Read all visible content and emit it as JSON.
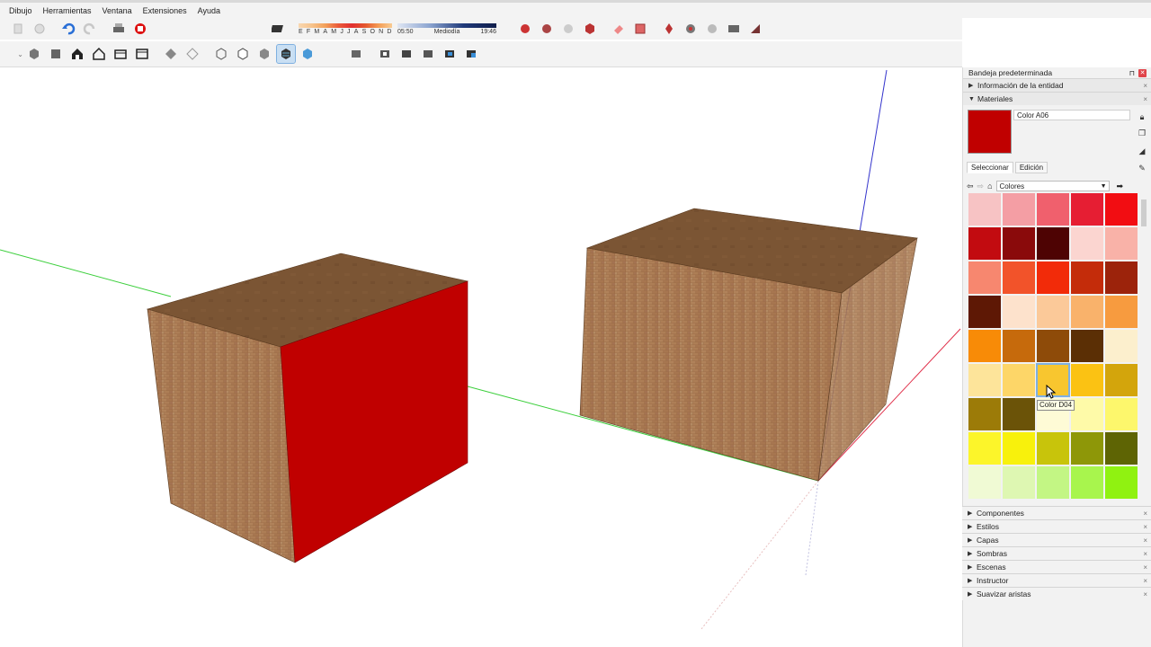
{
  "menu": [
    "Dibujo",
    "Herramientas",
    "Ventana",
    "Extensiones",
    "Ayuda"
  ],
  "shadow_widget": {
    "months": [
      "E",
      "F",
      "M",
      "A",
      "M",
      "J",
      "J",
      "A",
      "S",
      "O",
      "N",
      "D"
    ],
    "time_start": "05:50",
    "time_mid": "Mediodía",
    "time_end": "19:46"
  },
  "tray": {
    "title": "Bandeja predeterminada",
    "entity_info": "Información de la entidad",
    "materials": {
      "header": "Materiales",
      "current_name": "Color A06",
      "current_color": "#c00000",
      "tab_select": "Seleccionar",
      "tab_edit": "Edición",
      "library": "Colores",
      "swatches": [
        "#f7c3c4",
        "#f49ea4",
        "#f0606d",
        "#e61e33",
        "#f20d12",
        "#c20b10",
        "#8a0a0b",
        "#4e0303",
        "#fbd5d0",
        "#f9b2a8",
        "#f7876f",
        "#f2532a",
        "#f22b09",
        "#c42c0a",
        "#9c230b",
        "#5e1805",
        "#fde2cc",
        "#fbc999",
        "#f9b26b",
        "#f79b3f",
        "#f88b07",
        "#c66a0c",
        "#8e4b09",
        "#5b2f05",
        "#fcefcd",
        "#fde49a",
        "#fdd668",
        "#f8c62f",
        "#fbc213",
        "#d3a50c",
        "#9c7b08",
        "#6b5308",
        "#fefbd6",
        "#fefaa8",
        "#fdf76c",
        "#fcf52a",
        "#f8f10c",
        "#c8c40b",
        "#8e9708",
        "#5e6404",
        "#f0fad4",
        "#def7b2",
        "#c3f684",
        "#a8f54d",
        "#90f211"
      ],
      "selected_index": 27,
      "tooltip": "Color D04"
    },
    "collapsed_sections": [
      "Componentes",
      "Estilos",
      "Capas",
      "Sombras",
      "Escenas",
      "Instructor",
      "Suavizar aristas"
    ]
  }
}
